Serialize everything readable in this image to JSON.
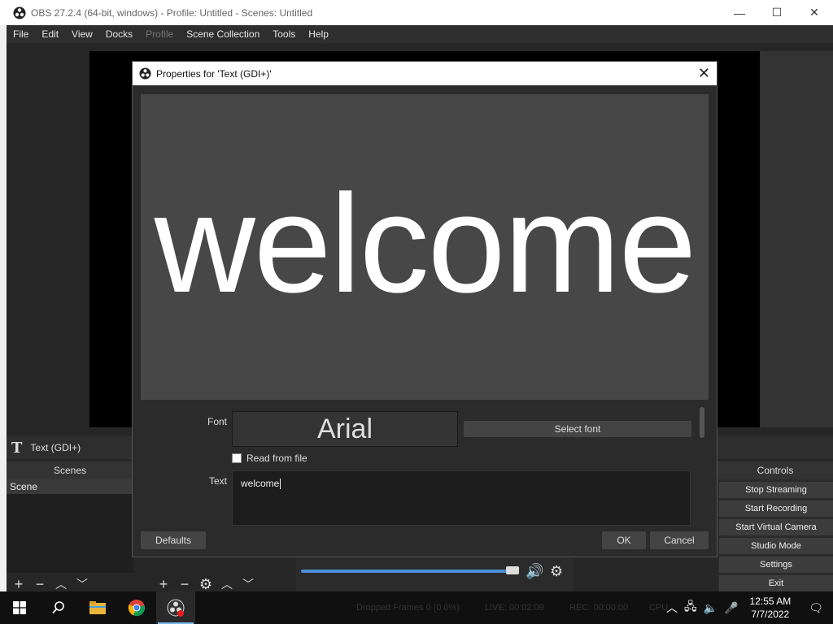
{
  "window": {
    "title": "OBS 27.2.4 (64-bit, windows) - Profile: Untitled - Scenes: Untitled",
    "minimize": "—",
    "maximize": "☐",
    "close": "✕"
  },
  "menu": [
    "File",
    "Edit",
    "View",
    "Docks",
    "Profile",
    "Scene Collection",
    "Tools",
    "Help"
  ],
  "source_toolbar": {
    "icon": "text-icon",
    "glyph": "T",
    "name": "Text (GDI+)"
  },
  "scenes": {
    "header": "Scenes",
    "items": [
      "Scene"
    ]
  },
  "controls": {
    "header": "Controls",
    "buttons": [
      "Stop Streaming",
      "Start Recording",
      "Start Virtual Camera",
      "Studio Mode",
      "Settings",
      "Exit"
    ]
  },
  "dialog": {
    "title": "Properties for 'Text (GDI+)'",
    "close": "✕",
    "preview_text": "welcome",
    "font_label": "Font",
    "font_value": "Arial",
    "select_font": "Select font",
    "read_from_file": "Read from file",
    "text_label": "Text",
    "text_value": "welcome",
    "defaults": "Defaults",
    "ok": "OK",
    "cancel": "Cancel"
  },
  "status": {
    "dropped": "Dropped Frames 0 (0.0%)",
    "live": "LIVE: 00:02:09",
    "rec": "REC: 00:00:00",
    "cpu": "CPU"
  },
  "taskbar": {
    "time": "12:55 AM",
    "date": "7/7/2022",
    "items": [
      "windows-start-icon",
      "search-icon",
      "file-explorer-icon",
      "chrome-icon",
      "obs-icon"
    ]
  }
}
